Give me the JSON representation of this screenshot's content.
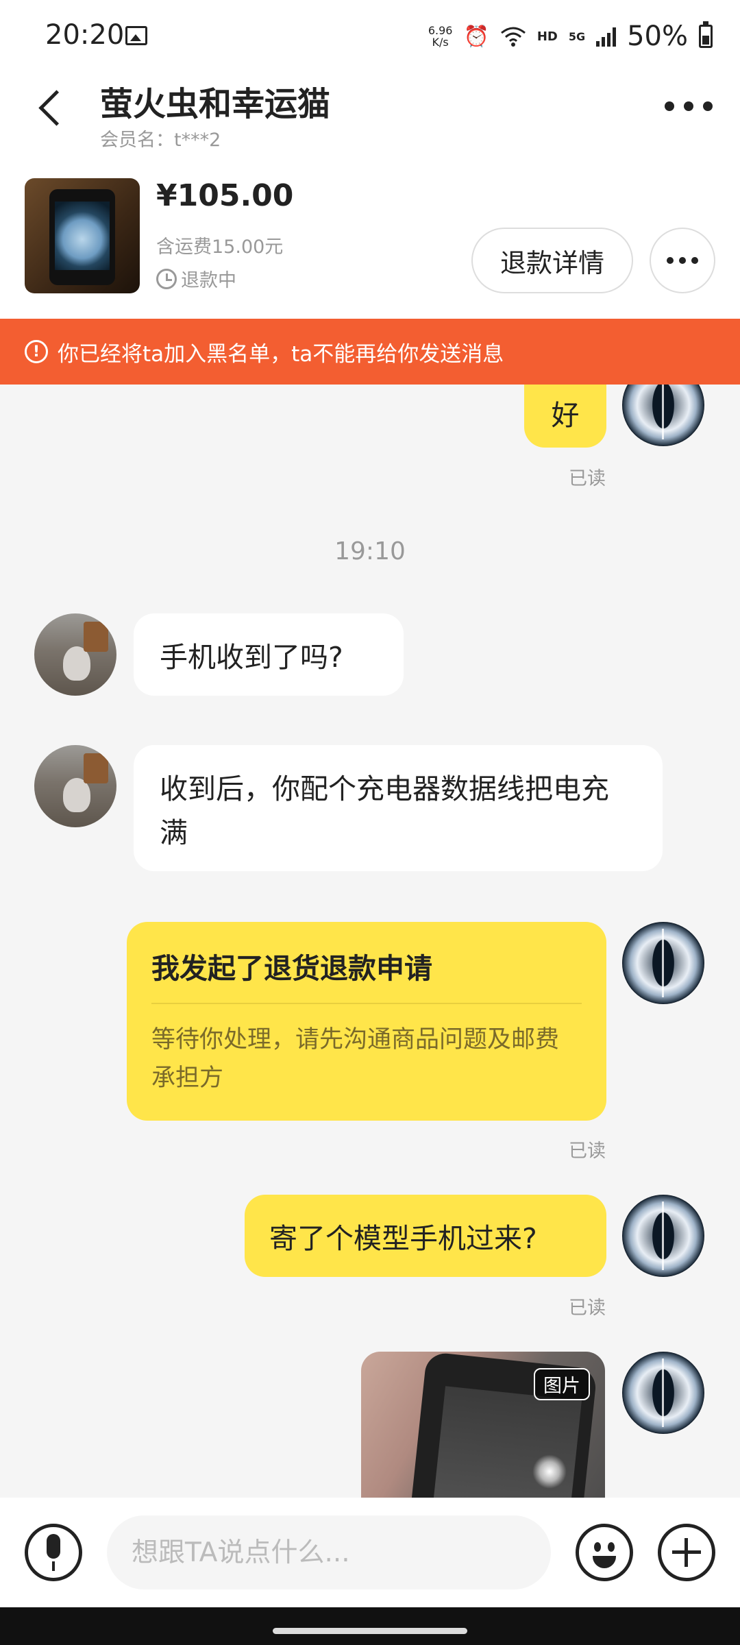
{
  "status_bar": {
    "time": "20:20",
    "net_speed_value": "6.96",
    "net_speed_unit": "K/s",
    "hd": "HD",
    "network": "5G",
    "battery": "50%",
    "icons": [
      "image-icon",
      "alarm-icon",
      "wifi-icon",
      "signal-icon",
      "battery-icon"
    ]
  },
  "header": {
    "title": "萤火虫和幸运猫",
    "member": "会员名：t***2"
  },
  "product": {
    "price": "¥105.00",
    "shipping": "含运费15.00元",
    "status": "退款中",
    "refund_button": "退款详情"
  },
  "banner": {
    "text": "你已经将ta加入黑名单，ta不能再给你发送消息"
  },
  "messages": {
    "m1": {
      "text": "好",
      "read": "已读"
    },
    "time_separator": "19:10",
    "m2": {
      "text": "手机收到了吗?"
    },
    "m3": {
      "text": "收到后，你配个充电器数据线把电充满"
    },
    "m4": {
      "title": "我发起了退货退款申请",
      "desc": "等待你处理，请先沟通商品问题及邮费承担方",
      "read": "已读"
    },
    "m5": {
      "text": "寄了个模型手机过来?",
      "read": "已读"
    },
    "m6": {
      "tag": "图片"
    }
  },
  "input": {
    "placeholder": "想跟TA说点什么..."
  },
  "colors": {
    "banner": "#f35e31",
    "self_bubble": "#ffe54a",
    "background": "#f5f5f5"
  }
}
